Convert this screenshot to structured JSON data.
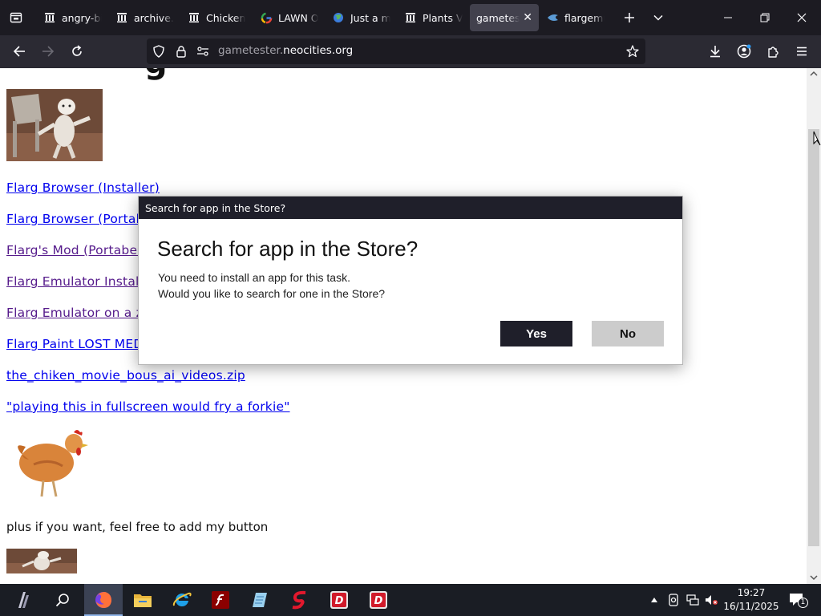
{
  "tabs": [
    {
      "label": "angry-bi",
      "icon": "archive-icon"
    },
    {
      "label": "archive.o",
      "icon": "archive-icon"
    },
    {
      "label": "Chicken",
      "icon": "archive-icon"
    },
    {
      "label": "LAWN OF",
      "icon": "google-icon"
    },
    {
      "label": "Just a mo",
      "icon": "globe-icon"
    },
    {
      "label": "Plants VS",
      "icon": "archive-icon"
    },
    {
      "label": "gameteste",
      "icon": "",
      "active": true
    },
    {
      "label": "flargemu",
      "icon": "flarg-icon"
    }
  ],
  "url": {
    "prefix": "gametester.",
    "host": "neocities.org"
  },
  "page": {
    "links": [
      {
        "text": "Flarg Browser (Installer)"
      },
      {
        "text": "Flarg Browser (Portab"
      },
      {
        "text": "Flarg's Mod (Portabel"
      },
      {
        "text": "Flarg Emulator Install"
      },
      {
        "text": "Flarg Emulator on a zi"
      },
      {
        "text": "Flarg Paint LOST MED"
      },
      {
        "text": "the_chiken_movie_bous_ai_videos.zip"
      },
      {
        "text": "\"playing this in fullscreen would fry a forkie\""
      }
    ],
    "note": "plus if you want, feel free to add my button"
  },
  "dialog": {
    "title": "Search for app in the Store?",
    "heading": "Search for app in the Store?",
    "line1": "You need to install an app for this task.",
    "line2": "Would you like to search for one in the Store?",
    "yes": "Yes",
    "no": "No"
  },
  "taskbar": {
    "apps": [
      "start-icon",
      "search-icon",
      "firefox-icon",
      "file-explorer-icon",
      "internet-explorer-icon",
      "flash-icon",
      "notepad-icon",
      "flarg-s-icon",
      "flarg-app-icon",
      "flarg-app-icon"
    ],
    "time": "19:27",
    "date": "16/11/2025",
    "notifications": "1"
  },
  "colors": {
    "tabbar_bg": "#1c1b22",
    "navbar_bg": "#2b2a33",
    "link": "#0000ee",
    "visited": "#551a8b",
    "dialog_dark": "#1f1f2a",
    "taskbar_bg": "#1a1d24"
  }
}
